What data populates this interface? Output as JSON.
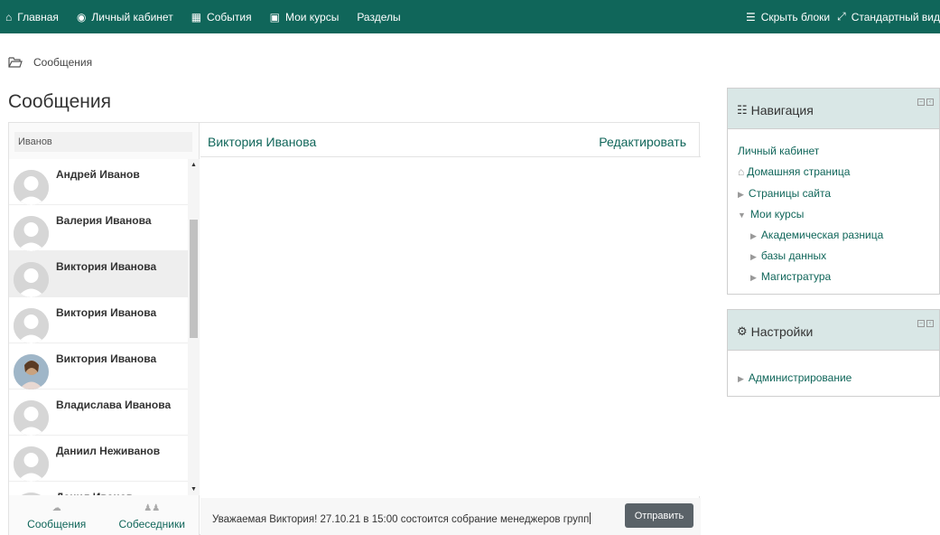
{
  "topnav": {
    "items": [
      {
        "label": "Главная",
        "icon": "home-icon"
      },
      {
        "label": "Личный кабинет",
        "icon": "dashboard-icon"
      },
      {
        "label": "События",
        "icon": "calendar-icon"
      },
      {
        "label": "Мои курсы",
        "icon": "briefcase-icon"
      },
      {
        "label": "Разделы"
      }
    ],
    "hide_blocks": "Скрыть блоки",
    "standard_view": "Стандартный вид"
  },
  "breadcrumb": {
    "label": "Сообщения"
  },
  "page_title": "Сообщения",
  "contacts": {
    "search_value": "Иванов",
    "items": [
      {
        "name": "Андрей Иванов",
        "selected": false,
        "has_photo": false
      },
      {
        "name": "Валерия Иванова",
        "selected": false,
        "has_photo": false
      },
      {
        "name": "Виктория Иванова",
        "selected": true,
        "has_photo": false
      },
      {
        "name": "Виктория Иванова",
        "selected": false,
        "has_photo": false
      },
      {
        "name": "Виктория Иванова",
        "selected": false,
        "has_photo": true
      },
      {
        "name": "Владислава Иванова",
        "selected": false,
        "has_photo": false
      },
      {
        "name": "Даниил Неживанов",
        "selected": false,
        "has_photo": false
      },
      {
        "name": "Данил Иванов",
        "selected": false,
        "has_photo": false
      }
    ],
    "tabs": {
      "messages": "Сообщения",
      "contacts": "Собеседники"
    }
  },
  "conversation": {
    "name": "Виктория Иванова",
    "edit_label": "Редактировать",
    "composer_text": "Уважаемая Виктория! 27.10.21 в 15:00 состоится собрание менеджеров групп",
    "send_label": "Отправить"
  },
  "navigation_block": {
    "title": "Навигация",
    "dashboard": "Личный кабинет",
    "home": "Домашняя страница",
    "site_pages": "Страницы сайта",
    "my_courses": "Мои курсы",
    "courses": [
      "Академическая разница",
      "базы данных",
      "Магистратура"
    ]
  },
  "settings_block": {
    "title": "Настройки",
    "admin": "Администрирование"
  },
  "colors": {
    "navbar": "#10665a",
    "link": "#10665a",
    "block_header": "#d9e7e6",
    "send_button": "#5a6268"
  }
}
